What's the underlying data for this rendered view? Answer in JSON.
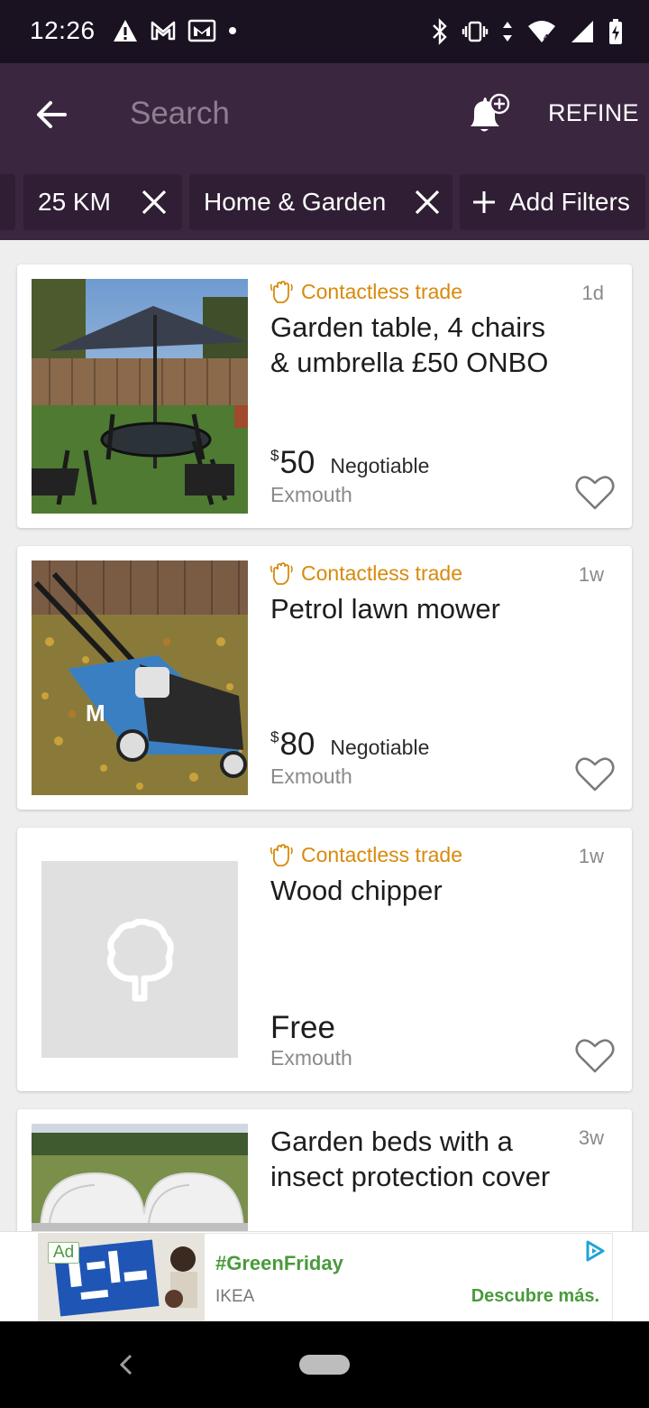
{
  "status_bar": {
    "time": "12:26"
  },
  "header": {
    "search_placeholder": "Search",
    "refine_label": "REFINE"
  },
  "filters": {
    "distance_label": "25 KM",
    "category_label": "Home & Garden",
    "add_filters_label": "Add Filters"
  },
  "listings": [
    {
      "badge": "Contactless trade",
      "age": "1d",
      "title": "Garden table, 4 chairs & umbrella £50 ONBO",
      "currency": "$",
      "price": "50",
      "negotiable": "Negotiable",
      "location": "Exmouth"
    },
    {
      "badge": "Contactless trade",
      "age": "1w",
      "title": "Petrol lawn mower",
      "currency": "$",
      "price": "80",
      "negotiable": "Negotiable",
      "location": "Exmouth"
    },
    {
      "badge": "Contactless trade",
      "age": "1w",
      "title": "Wood chipper",
      "price": "Free",
      "location": "Exmouth"
    },
    {
      "age": "3w",
      "title": "Garden beds with a insect protection cover"
    }
  ],
  "ad": {
    "badge": "Ad",
    "headline": "#GreenFriday",
    "advertiser": "IKEA",
    "cta": "Descubre más."
  },
  "colors": {
    "app_bar": "#3b2640",
    "status_bar": "#1a1121",
    "accent_orange": "#d88a0c",
    "ad_green": "#4a9a3c"
  }
}
